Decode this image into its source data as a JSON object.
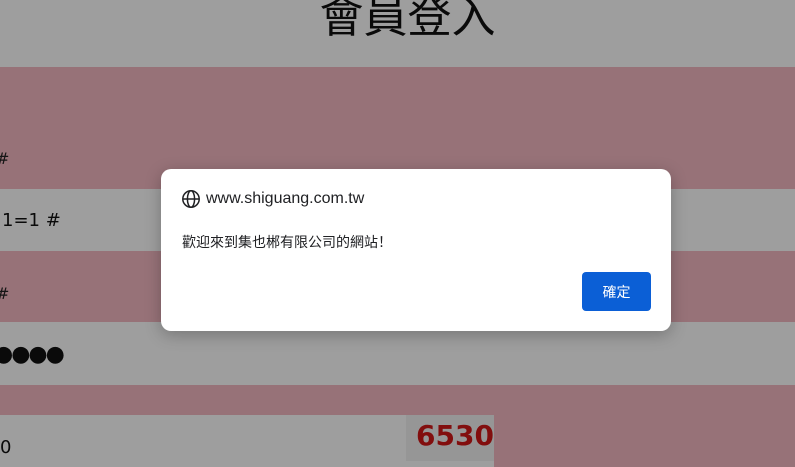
{
  "page": {
    "title": "會員登入",
    "labels": {
      "account": "#",
      "password": "#"
    },
    "fields": {
      "account_value": "1=1 #",
      "password_value": "●●●●",
      "captcha_input": "0"
    },
    "captcha": {
      "code": "6530",
      "color": "#d21818"
    }
  },
  "dialog": {
    "origin": "www.shiguang.com.tw",
    "message": "歡迎來到集也郴有限公司的網站！",
    "ok_label": "確定",
    "accent_color": "#0b5fd6"
  }
}
